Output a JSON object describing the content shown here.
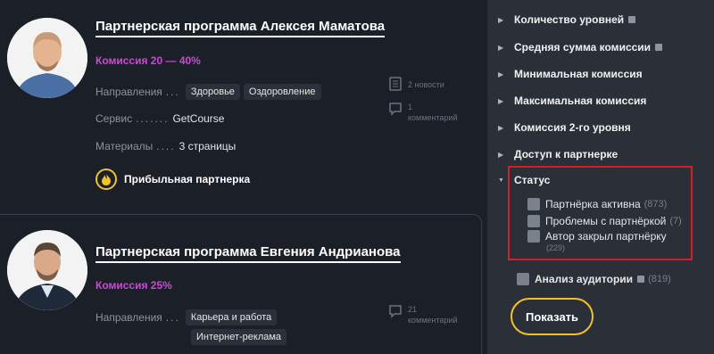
{
  "programs": [
    {
      "title": "Партнерская программа Алексея Маматова",
      "commission": "Комиссия 20 — 40%",
      "directions_label": "Направления",
      "directions": [
        "Здоровье",
        "Оздоровление"
      ],
      "service_label": "Сервис",
      "service": "GetCourse",
      "materials_label": "Материалы",
      "materials": "3 страницы",
      "badge": "Прибыльная партнерка",
      "news": "2 новости",
      "comments_count": "1",
      "comments_word": "комментарий"
    },
    {
      "title": "Партнерская программа Евгения Андрианова",
      "commission": "Комиссия 25%",
      "directions_label": "Направления",
      "directions": [
        "Карьера и работа",
        "Интернет-реклама"
      ],
      "comments_count": "21",
      "comments_word": "комментарий"
    }
  ],
  "filters": {
    "levels": "Количество уровней",
    "avg_commission": "Средняя сумма комиссии",
    "min_commission": "Минимальная комиссия",
    "max_commission": "Максимальная комиссия",
    "second_level": "Комиссия 2-го уровня",
    "access": "Доступ к партнерке",
    "status": {
      "title": "Статус",
      "options": [
        {
          "label": "Партнёрка активна",
          "count": "(873)"
        },
        {
          "label": "Проблемы с партнёркой",
          "count": "(7)"
        },
        {
          "label": "Автор закрыл партнёрку",
          "count": "(229)"
        }
      ]
    },
    "audience": {
      "label": "Анализ аудитории",
      "count": "(819)"
    },
    "show_button": "Показать"
  },
  "icons": {
    "arrow_right": "triangle-right-icon",
    "arrow_down": "triangle-down-icon",
    "info": "info-icon",
    "news": "document-icon",
    "comment": "speech-bubble-icon",
    "fire": "flame-icon"
  },
  "colors": {
    "accent_commission": "#c94bd3",
    "accent_button": "#f2c12e",
    "highlight_box": "#d32027"
  }
}
